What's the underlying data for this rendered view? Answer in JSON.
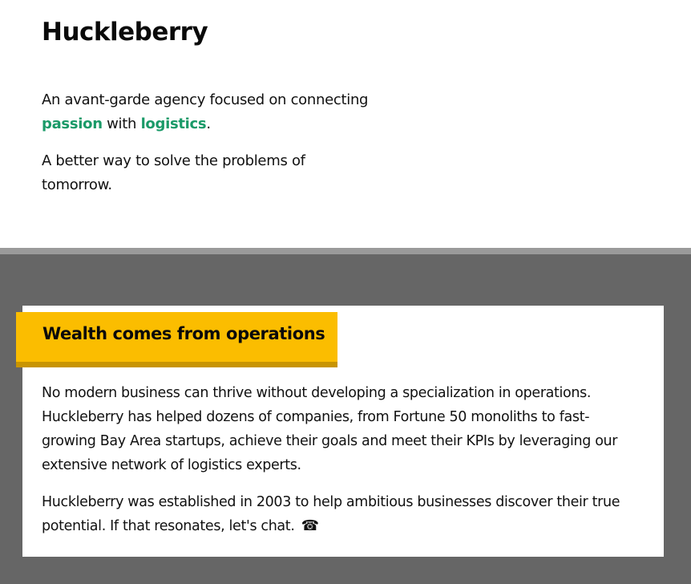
{
  "site": {
    "title": "Huckleberry"
  },
  "hero": {
    "line1_pre": "An avant-garde agency focused on connecting ",
    "accent1": "passion",
    "line1_mid": " with ",
    "accent2": "logistics",
    "line1_post": ".",
    "line2": "A better way to solve the problems of tomorrow."
  },
  "card": {
    "heading": "Wealth comes from operations",
    "paragraph1": "No modern business can thrive without developing a specialization in operations. Huckleberry has helped dozens of companies, from Fortune 50 monoliths to fast-growing Bay Area startups, achieve their goals and meet their KPIs by leveraging our extensive network of logistics experts.",
    "paragraph2": "Huckleberry was established in 2003 to help ambitious businesses discover their true potential. If that resonates, let's chat.",
    "contact_icon": "☎"
  },
  "colors": {
    "accent": "#1a9a68",
    "heading_band": "#fbbd00",
    "heading_band_shadow": "#c89400",
    "lower_background": "#666666",
    "divider": "#9a9a9a"
  },
  "icons": {
    "contact": "telephone-icon"
  }
}
